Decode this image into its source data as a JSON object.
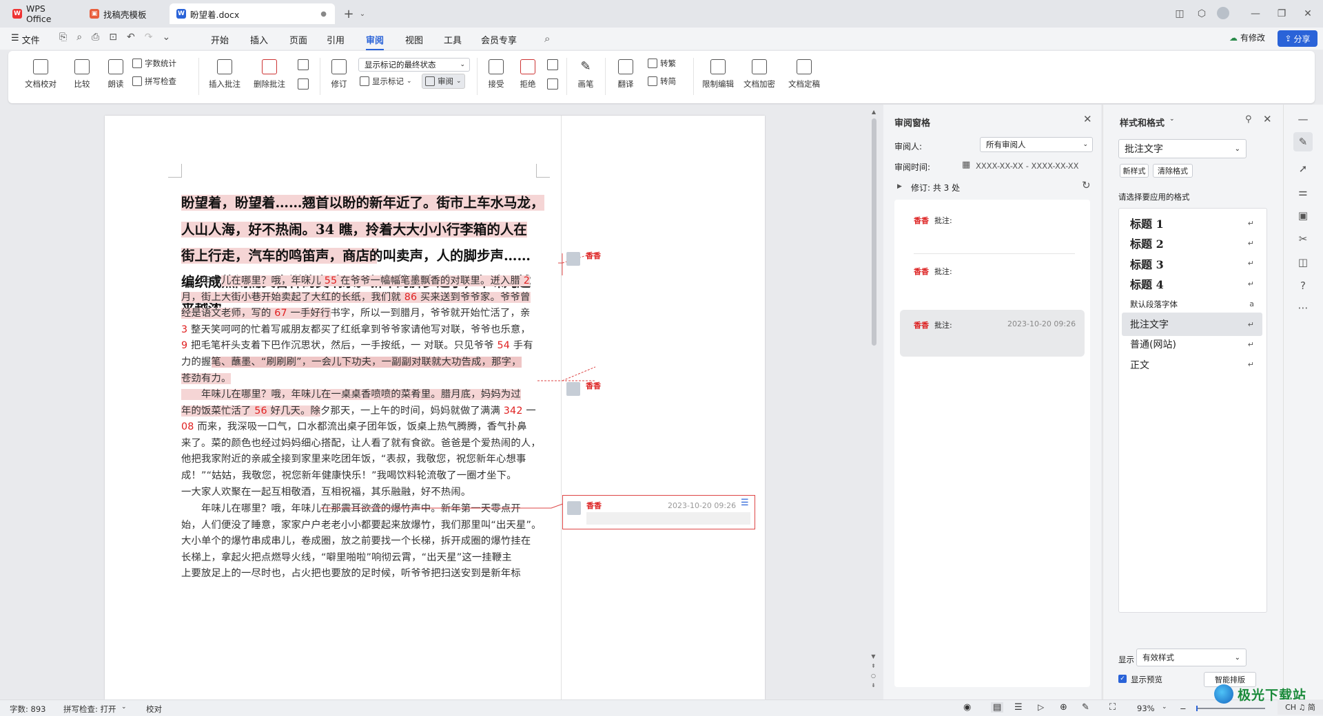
{
  "tabs": [
    {
      "label": "WPS Office"
    },
    {
      "label": "找稿壳模板"
    },
    {
      "label": "盼望着.docx"
    }
  ],
  "menu": {
    "file": "文件",
    "items": [
      "开始",
      "插入",
      "页面",
      "引用",
      "审阅",
      "视图",
      "工具",
      "会员专享"
    ],
    "active": "审阅",
    "modified": "有修改",
    "share": "分享"
  },
  "ribbon": {
    "doc_check": "文档校对",
    "compare": "比较",
    "read_aloud": "朗读",
    "word_count": "字数统计",
    "spell_check": "拼写检查",
    "insert_comment": "插入批注",
    "delete_comment": "删除批注",
    "track": "修订",
    "markup_state": "显示标记的最终状态",
    "show_markup": "显示标记",
    "review": "审阅",
    "accept": "接受",
    "reject": "拒绝",
    "pen": "画笔",
    "translate": "翻译",
    "to_trad": "转繁",
    "to_simp": "转简",
    "restrict": "限制编辑",
    "encrypt": "文档加密",
    "finalize": "文档定稿"
  },
  "document": {
    "title_lines": [
      "盼望着，盼望着……翘首以盼的新年近了。街市上车水马龙，",
      "人山人海，好不热闹。34 瞧，拎着大大小小行李箱的人在",
      "街上行走，汽车的鸣笛声，商店的叫卖声，人的脚步声……",
      "编织成热闹而又吉祥的交响乐。新年的脚步近了，年味儿越",
      "来越浓。"
    ],
    "para1": [
      {
        "pre": "　　年味",
        "hl": "儿在哪里？哦，年味儿 ",
        "n1": "55",
        "mid": " 在爷爷一幅幅笔墨飘香的对联里。进入腊 ",
        "n2": "2"
      },
      {
        "hl": "月，街上大街小巷开始卖起了大红的长纸，我们就 ",
        "n1": "86",
        "mid": " 买来送到爷爷家。爷爷曾"
      },
      {
        "hl": "经是语文老师，写的 ",
        "n1": "67",
        "mid": " 一手好行",
        "post": "书字，所以一到腊月，爷爷就开始忙活了，亲"
      },
      {
        "post": "戚朋友都买了红纸拿到爷爷家请他写对联，爷爷也乐意，",
        "n1": "3",
        "mid": " 整天笑呵呵的忙着写"
      },
      {
        "post": "对联。只见爷爷 ",
        "n1": "9",
        "mid": " 把毛笔杆头支着下巴作沉思状，然后，一手按纸，一 ",
        "n2": "54",
        "tail": " 手有"
      },
      {
        "post": "力的握",
        "hl": "笔、蘸墨、“刷刷刷”，一会儿下功夫，一副副对联就大功告成，那字，"
      },
      {
        "hl": "苍劲有力。"
      }
    ],
    "para2": [
      {
        "hl": "　　年味儿在哪里？哦，年味儿在一桌桌香喷喷的菜肴里。腊月底，妈妈为过"
      },
      {
        "hl": "年的饭菜忙活了 ",
        "n1": "56",
        "mid": " 好几天。除",
        "post": "夕那天，一上午的时间，妈妈就做了满满 ",
        "n2": "342",
        "tail": " 一"
      },
      {
        "post": "桌子团年饭，饭桌上热气腾腾，香气扑鼻 ",
        "n1": "08",
        "mid": " 而来，我深吸一口气，口水都流出"
      },
      {
        "post": "来了。菜的颜色也经过妈妈细心搭配，让人看了就有食欲。爸爸是个爱热闹的人，"
      },
      {
        "post": "他把我家附近的亲戚全接到家里来吃团年饭，“表叔，我敬您，祝您新年心想事"
      },
      {
        "post": "成！”“姑姑，我敬您，祝您新年健康快乐！”我喝饮料轮流敬了一圈才坐下。"
      },
      {
        "post": "一大家人欢聚在一起互相敬酒，互相祝福，其乐融融，好不热闹。"
      }
    ],
    "para3": [
      "　　年味儿在哪里？哦，年味儿在那震耳欲聋的爆竹声中。新年第一天零点开",
      "始，人们便没了睡意，家家户户老老小小都要起来放爆竹，我们那里叫“出天星”。",
      "大小单个的爆竹串成串儿，卷成圈，放之前要找一个长梯，拆开成圈的爆竹挂在",
      "长梯上，拿起火把点燃导火线，“噼里啪啦”响彻云霄，“出天星”这一挂鞭主",
      "上要放足上的一尽时也，占火把也要放的足时候，听爷爷把扫送安到是新年标"
    ],
    "comments": [
      {
        "name": "香香"
      },
      {
        "name": "香香"
      },
      {
        "name": "香香",
        "time": "2023-10-20 09:26"
      }
    ]
  },
  "review_pane": {
    "title": "审阅窗格",
    "reviewer_label": "审阅人:",
    "reviewer_value": "所有审阅人",
    "time_label": "审阅时间:",
    "time_value": "XXXX-XX-XX  -  XXXX-XX-XX",
    "revisions": "修订:  共 3 处",
    "items": [
      {
        "name": "香香",
        "type": "批注:"
      },
      {
        "name": "香香",
        "type": "批注:"
      },
      {
        "name": "香香",
        "type": "批注:",
        "time": "2023-10-20 09:26"
      }
    ]
  },
  "style_pane": {
    "title": "样式和格式",
    "current": "批注文字",
    "new_style": "新样式",
    "clear_format": "清除格式",
    "prompt": "请选择要应用的格式",
    "styles": [
      "标题  1",
      "标题  2",
      "标题  3",
      "标题  4",
      "默认段落字体",
      "批注文字",
      "普通(网站)",
      "正文"
    ],
    "show_label": "显示",
    "show_value": "有效样式",
    "preview": "显示预览",
    "smart": "智能排版"
  },
  "status": {
    "words": "字数: 893",
    "spell": "拼写检查: 打开",
    "proof": "校对",
    "zoom": "93%"
  },
  "watermark": "极光下载站",
  "ime": "CH ♫ 简"
}
